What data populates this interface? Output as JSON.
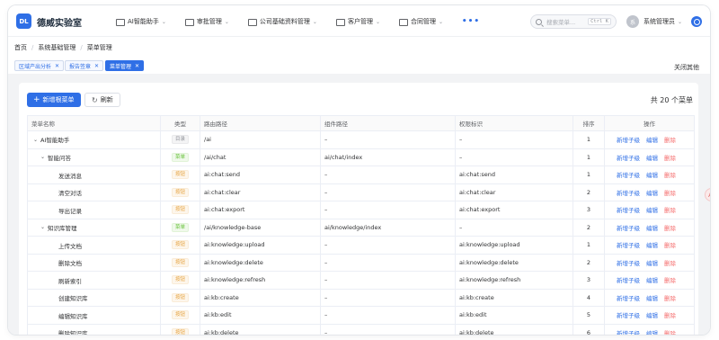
{
  "app": {
    "logo_text": "DL",
    "title": "德威实验室"
  },
  "nav": [
    {
      "label": "AI智能助手",
      "icon": "ai-icon"
    },
    {
      "label": "审批管理",
      "icon": "approval-icon"
    },
    {
      "label": "公司基础资料管理",
      "icon": "company-icon"
    },
    {
      "label": "客户管理",
      "icon": "customer-icon"
    },
    {
      "label": "合同管理",
      "icon": "contract-icon"
    }
  ],
  "nav_more": "•••",
  "search": {
    "placeholder": "搜索菜单...",
    "shortcut": "Ctrl K"
  },
  "user": {
    "avatar_text": "系",
    "name": "系统管理员"
  },
  "breadcrumb": [
    "首页",
    "系统基础管理",
    "菜单管理"
  ],
  "tabs": [
    {
      "label": "区域产出分析",
      "active": false
    },
    {
      "label": "报告签章",
      "active": false
    },
    {
      "label": "菜单管理",
      "active": true
    }
  ],
  "close_others": "关闭其他",
  "toolbar": {
    "add_root": "新增根菜单",
    "refresh": "刷新",
    "total": "共 20 个菜单"
  },
  "table": {
    "headers": [
      "菜单名称",
      "类型",
      "路由路径",
      "组件路径",
      "权限标识",
      "排序",
      "操作"
    ],
    "ops": {
      "add_child": "新增子级",
      "edit": "编辑",
      "delete": "删除"
    },
    "rows": [
      {
        "name": "AI智能助手",
        "level": 0,
        "expand": true,
        "type": "目录",
        "kind": "dir",
        "path": "/ai",
        "component": "–",
        "perm": "–",
        "sort": "1"
      },
      {
        "name": "智能问答",
        "level": 1,
        "expand": true,
        "type": "菜单",
        "kind": "menu",
        "path": "/ai/chat",
        "component": "ai/chat/index",
        "perm": "–",
        "sort": "1"
      },
      {
        "name": "发送消息",
        "level": 2,
        "expand": false,
        "type": "按钮",
        "kind": "btn",
        "path": "ai:chat:send",
        "component": "–",
        "perm": "ai:chat:send",
        "sort": "1"
      },
      {
        "name": "清空对话",
        "level": 2,
        "expand": false,
        "type": "按钮",
        "kind": "btn",
        "path": "ai:chat:clear",
        "component": "–",
        "perm": "ai:chat:clear",
        "sort": "2"
      },
      {
        "name": "导出记录",
        "level": 2,
        "expand": false,
        "type": "按钮",
        "kind": "btn",
        "path": "ai:chat:export",
        "component": "–",
        "perm": "ai:chat:export",
        "sort": "3"
      },
      {
        "name": "知识库管理",
        "level": 1,
        "expand": true,
        "type": "菜单",
        "kind": "menu",
        "path": "/ai/knowledge-base",
        "component": "ai/knowledge/index",
        "perm": "–",
        "sort": "2"
      },
      {
        "name": "上传文档",
        "level": 2,
        "expand": false,
        "type": "按钮",
        "kind": "btn",
        "path": "ai:knowledge:upload",
        "component": "–",
        "perm": "ai:knowledge:upload",
        "sort": "1"
      },
      {
        "name": "删除文档",
        "level": 2,
        "expand": false,
        "type": "按钮",
        "kind": "btn",
        "path": "ai:knowledge:delete",
        "component": "–",
        "perm": "ai:knowledge:delete",
        "sort": "2"
      },
      {
        "name": "刷新索引",
        "level": 2,
        "expand": false,
        "type": "按钮",
        "kind": "btn",
        "path": "ai:knowledge:refresh",
        "component": "–",
        "perm": "ai:knowledge:refresh",
        "sort": "3"
      },
      {
        "name": "创建知识库",
        "level": 2,
        "expand": false,
        "type": "按钮",
        "kind": "btn",
        "path": "ai:kb:create",
        "component": "–",
        "perm": "ai:kb:create",
        "sort": "4"
      },
      {
        "name": "编辑知识库",
        "level": 2,
        "expand": false,
        "type": "按钮",
        "kind": "btn",
        "path": "ai:kb:edit",
        "component": "–",
        "perm": "ai:kb:edit",
        "sort": "5"
      },
      {
        "name": "删除知识库",
        "level": 2,
        "expand": false,
        "type": "按钮",
        "kind": "btn",
        "path": "ai:kb:delete",
        "component": "–",
        "perm": "ai:kb:delete",
        "sort": "6"
      }
    ]
  },
  "floating_action": {
    "icon": "assistant-icon",
    "text": "AI"
  },
  "colors": {
    "primary": "#2f6fe6",
    "danger": "#f56c6c",
    "success": "#67c23a",
    "warning": "#e6a23c"
  }
}
